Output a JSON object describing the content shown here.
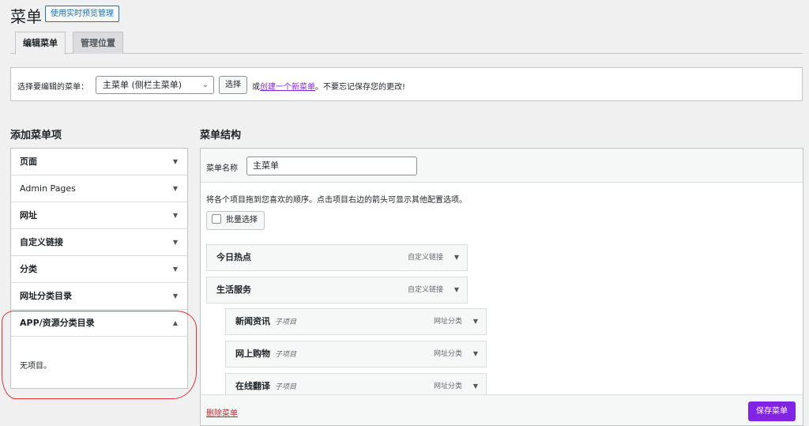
{
  "header": {
    "title": "菜单",
    "preview_button": "使用实时预览管理"
  },
  "tabs": [
    {
      "label": "编辑菜单"
    },
    {
      "label": "管理位置"
    }
  ],
  "select_bar": {
    "label": "选择要编辑的菜单：",
    "selected_menu": "主菜单 (侧栏主菜单)",
    "select_button": "选择",
    "note_prefix": "或",
    "note_link": "创建一个新菜单",
    "note_suffix": "。不要忘记保存您的更改!"
  },
  "add_items": {
    "title": "添加菜单项",
    "sections": [
      {
        "label": "页面"
      },
      {
        "label": "Admin Pages"
      },
      {
        "label": "网址"
      },
      {
        "label": "自定义链接"
      },
      {
        "label": "分类"
      },
      {
        "label": "网址分类目录"
      },
      {
        "label": "APP/资源分类目录"
      }
    ],
    "empty_text": "无项目。"
  },
  "structure": {
    "title": "菜单结构",
    "menu_name_label": "菜单名称",
    "menu_name_value": "主菜单",
    "instructions": "将各个项目拖到您喜欢的顺序。点击项目右边的箭头可显示其他配置选项。",
    "bulk_select": "批量选择",
    "items": [
      {
        "title": "今日热点",
        "sub": "",
        "type": "自定义链接"
      },
      {
        "title": "生活服务",
        "sub": "",
        "type": "自定义链接"
      },
      {
        "title": "新闻资讯",
        "sub": "子项目",
        "type": "网址分类"
      },
      {
        "title": "网上购物",
        "sub": "子项目",
        "type": "网址分类"
      },
      {
        "title": "在线翻译",
        "sub": "子项目",
        "type": "网址分类"
      }
    ],
    "delete_link": "删除菜单",
    "save_button": "保存菜单"
  },
  "colors": {
    "accent": "#8224e3",
    "link": "#2271b1",
    "annotation": "#d63638"
  }
}
